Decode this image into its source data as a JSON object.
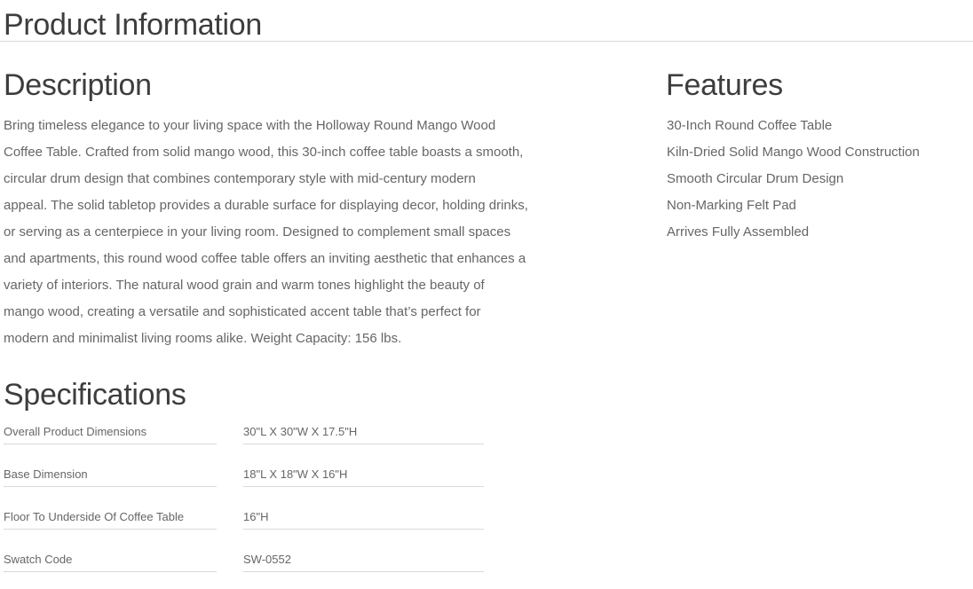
{
  "page": {
    "title": "Product Information"
  },
  "description": {
    "heading": "Description",
    "lines": [
      "Bring timeless elegance to your living space with the Holloway Round Mango Wood",
      "Coffee Table. Crafted from solid mango wood, this 30-inch coffee table boasts a smooth,",
      "circular drum design that combines contemporary style with mid-century modern",
      "appeal. The solid tabletop provides a durable surface for displaying decor, holding drinks,",
      "or serving as a centerpiece in your living room. Designed to complement small spaces",
      "and apartments, this round wood coffee table offers an inviting aesthetic that enhances a",
      "variety of interiors. The natural wood grain and warm tones highlight the beauty of",
      "mango wood, creating a versatile and sophisticated accent table that’s perfect for",
      "modern and minimalist living rooms alike. Weight Capacity: 156 lbs."
    ]
  },
  "features": {
    "heading": "Features",
    "items": [
      "30-Inch Round Coffee Table",
      "Kiln-Dried Solid Mango Wood Construction",
      "Smooth Circular Drum Design",
      "Non-Marking Felt Pad",
      "Arrives Fully Assembled"
    ]
  },
  "specifications": {
    "heading": "Specifications",
    "rows": [
      {
        "label": "Overall Product Dimensions",
        "value": "30\"L X 30\"W X 17.5\"H"
      },
      {
        "label": "Base Dimension",
        "value": "18\"L X 18\"W X 16\"H"
      },
      {
        "label": "Floor To Underside Of Coffee Table",
        "value": "16\"H"
      },
      {
        "label": "Swatch Code",
        "value": "SW-0552"
      }
    ]
  },
  "colors": {
    "heading_text": "#3d3d3d",
    "body_text": "#666666",
    "rule": "#d9d9d9",
    "background": "#ffffff"
  }
}
